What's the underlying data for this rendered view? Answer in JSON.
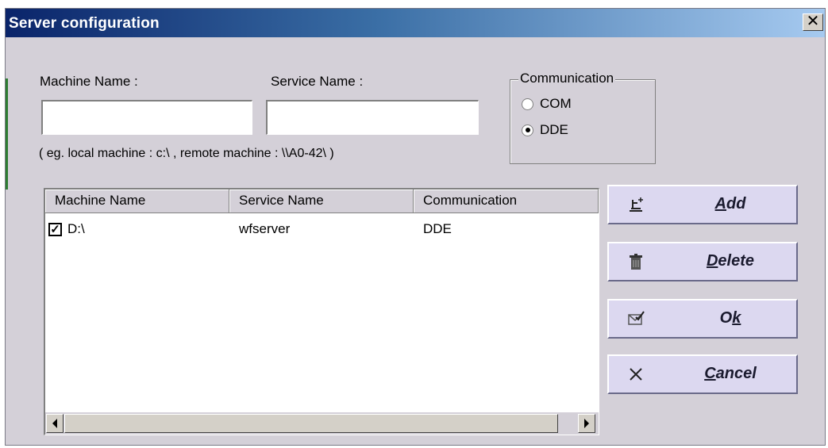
{
  "window": {
    "title": "Server configuration",
    "close_glyph": "✕"
  },
  "form": {
    "machine_label": "Machine Name :",
    "machine_value": "",
    "service_label": "Service Name :",
    "service_value": "",
    "hint": "( eg. local machine : c:\\ , remote machine : \\\\A0-42\\ )"
  },
  "communication": {
    "legend": "Communication",
    "options": [
      {
        "label": "COM",
        "selected": false
      },
      {
        "label": "DDE",
        "selected": true
      }
    ]
  },
  "list": {
    "columns": [
      "Machine Name",
      "Service Name",
      "Communication"
    ],
    "rows": [
      {
        "checked": true,
        "machine": "D:\\",
        "service": "wfserver",
        "communication": "DDE"
      }
    ]
  },
  "buttons": {
    "add": {
      "pre": "",
      "u": "A",
      "post": "dd",
      "icon": "add-server-icon"
    },
    "delete": {
      "pre": "",
      "u": "D",
      "post": "elete",
      "icon": "trash-icon"
    },
    "ok": {
      "pre": "O",
      "u": "k",
      "post": "",
      "icon": "checkmark-envelope-icon"
    },
    "cancel": {
      "pre": "",
      "u": "C",
      "post": "ancel",
      "icon": "x-icon"
    }
  }
}
